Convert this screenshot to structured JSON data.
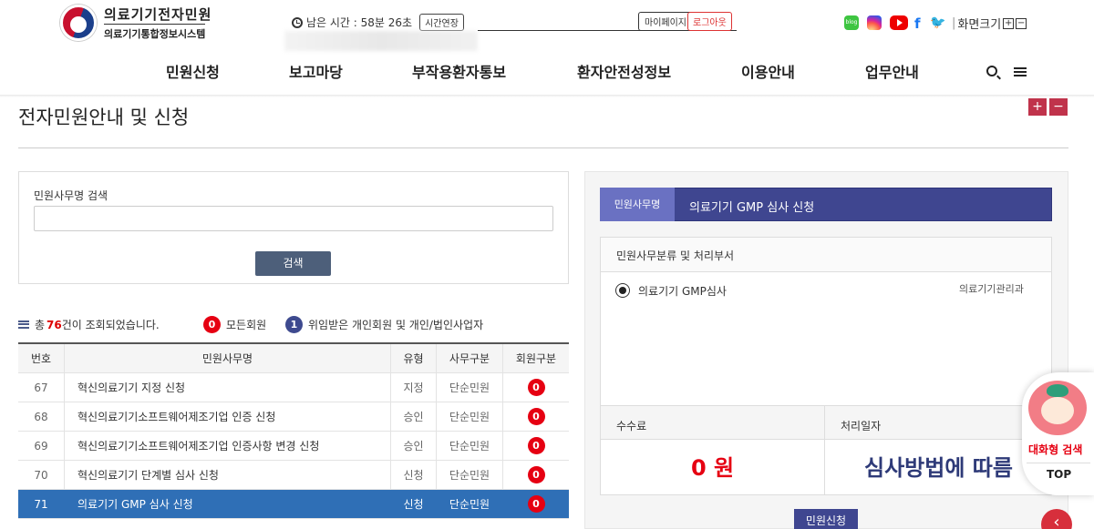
{
  "header": {
    "site_title": "의료기기전자민원",
    "site_subtitle": "의료기기통합정보시스템",
    "timer_text": "남은 시간 : 58분 26초",
    "extend_button": "시간연장",
    "mypage_button": "마이페이지",
    "logout_button": "로그아웃",
    "font_size_label": "화면크기",
    "font_size_plus": "+",
    "font_size_minus": "−",
    "blog_label": "blog"
  },
  "nav": {
    "items": [
      "민원신청",
      "보고마당",
      "부작용환자통보",
      "환자안전성정보",
      "이용안내",
      "업무안내"
    ]
  },
  "page": {
    "title": "전자민원안내 및 신청",
    "zoom_in": "+",
    "zoom_out": "−"
  },
  "search": {
    "label": "민원사무명 검색",
    "placeholder": "",
    "button": "검색"
  },
  "summary": {
    "prefix": "총",
    "count": "76",
    "suffix": "건이 조회되었습니다.",
    "legend_0_badge": "0",
    "legend_0_label": "모든회원",
    "legend_1_badge": "1",
    "legend_1_label": "위임받은 개인회원 및 개인/법인사업자"
  },
  "table": {
    "headers": [
      "번호",
      "민원사무명",
      "유형",
      "사무구분",
      "회원구분"
    ],
    "rows": [
      {
        "no": "67",
        "name": "혁신의료기기 지정 신청",
        "type": "지정",
        "category": "단순민원",
        "member": "0"
      },
      {
        "no": "68",
        "name": "혁신의료기기소프트웨어제조기업 인증 신청",
        "type": "승인",
        "category": "단순민원",
        "member": "0"
      },
      {
        "no": "69",
        "name": "혁신의료기기소프트웨어제조기업 인증사항 변경 신청",
        "type": "승인",
        "category": "단순민원",
        "member": "0"
      },
      {
        "no": "70",
        "name": "혁신의료기기 단계별 심사 신청",
        "type": "신청",
        "category": "단순민원",
        "member": "0"
      },
      {
        "no": "71",
        "name": "의료기기 GMP 심사 신청",
        "type": "신청",
        "category": "단순민원",
        "member": "0"
      }
    ]
  },
  "detail": {
    "tag": "민원사무명",
    "name": "의료기기 GMP 심사 신청",
    "box_header": "민원사무분류 및 처리부서",
    "option_label": "의료기기 GMP심사",
    "department": "의료기기관리과",
    "fee_label": "수수료",
    "date_label": "처리일자",
    "fee_value": "0 원",
    "date_value": "심사방법에 따름",
    "apply_button": "민원신청"
  },
  "floating": {
    "chatbot_label": "대화형 검색",
    "top_label": "TOP",
    "back_icon": "‹"
  },
  "colors": {
    "accent_red": "#e60012",
    "navy": "#3f4690",
    "selected_row": "#2f6fb6"
  }
}
